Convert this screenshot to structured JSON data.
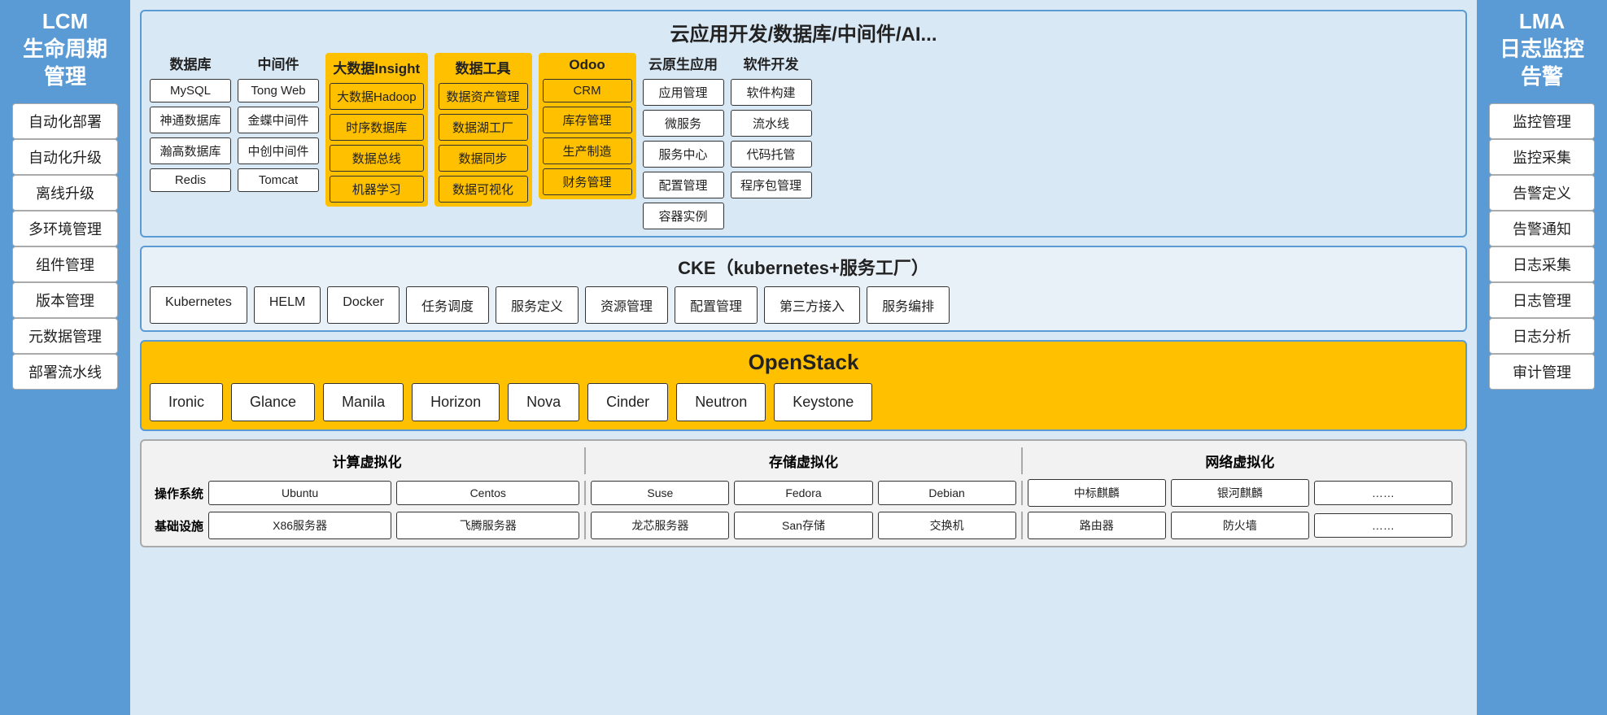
{
  "left_sidebar": {
    "title": "LCM\n生命周期\n管理",
    "items": [
      "自动化部署",
      "自动化升级",
      "离线升级",
      "多环境管理",
      "组件管理",
      "版本管理",
      "元数据管理",
      "部署流水线"
    ]
  },
  "right_sidebar": {
    "title": "LMA\n日志监控\n告警",
    "items": [
      "监控管理",
      "监控采集",
      "告警定义",
      "告警通知",
      "日志采集",
      "日志管理",
      "日志分析",
      "审计管理"
    ]
  },
  "cloud_section": {
    "title": "云应用开发/数据库/中间件/AI...",
    "columns": [
      {
        "type": "normal",
        "title": "数据库",
        "items": [
          "MySQL",
          "神通数据库",
          "瀚高数据库",
          "Redis"
        ]
      },
      {
        "type": "normal",
        "title": "中间件",
        "items": [
          "Tong Web",
          "金蝶中间件",
          "中创中间件",
          "Tomcat"
        ]
      },
      {
        "type": "highlight",
        "title": "大数据Insight",
        "items": [
          "大数据Hadoop",
          "时序数据库",
          "数据总线",
          "机器学习"
        ]
      },
      {
        "type": "highlight",
        "title": "数据工具",
        "items": [
          "数据资产管理",
          "数据湖工厂",
          "数据同步",
          "数据可视化"
        ]
      },
      {
        "type": "highlight",
        "title": "Odoo",
        "items": [
          "CRM",
          "库存管理",
          "生产制造",
          "财务管理"
        ]
      },
      {
        "type": "normal",
        "title": "云原生应用",
        "items": [
          "应用管理",
          "微服务",
          "服务中心",
          "配置管理",
          "容器实例"
        ]
      },
      {
        "type": "normal",
        "title": "软件开发",
        "items": [
          "软件构建",
          "流水线",
          "代码托管",
          "程序包管理"
        ]
      }
    ]
  },
  "cke_section": {
    "title": "CKE（kubernetes+服务工厂）",
    "items": [
      "Kubernetes",
      "HELM",
      "Docker",
      "任务调度",
      "服务定义",
      "资源管理",
      "配置管理",
      "第三方接入",
      "服务编排"
    ]
  },
  "openstack_section": {
    "title": "OpenStack",
    "items": [
      "Ironic",
      "Glance",
      "Manila",
      "Horizon",
      "Nova",
      "Cinder",
      "Neutron",
      "Keystone"
    ]
  },
  "virt_section": {
    "groups": [
      {
        "title": "计算虚拟化",
        "os_label": "操作系统",
        "infra_label": "基础设施",
        "os_items": [
          "Ubuntu",
          "Centos"
        ],
        "infra_items": [
          "X86服务器",
          "飞腾服务器"
        ]
      },
      {
        "title": "存储虚拟化",
        "os_label": "",
        "infra_label": "",
        "os_items": [
          "Suse",
          "Fedora",
          "Debian"
        ],
        "infra_items": [
          "龙芯服务器",
          "San存储",
          "交换机"
        ]
      },
      {
        "title": "网络虚拟化",
        "os_label": "",
        "infra_label": "",
        "os_items": [
          "中标麒麟",
          "银河麒麟",
          "……"
        ],
        "infra_items": [
          "路由器",
          "防火墙",
          "……"
        ]
      }
    ]
  }
}
